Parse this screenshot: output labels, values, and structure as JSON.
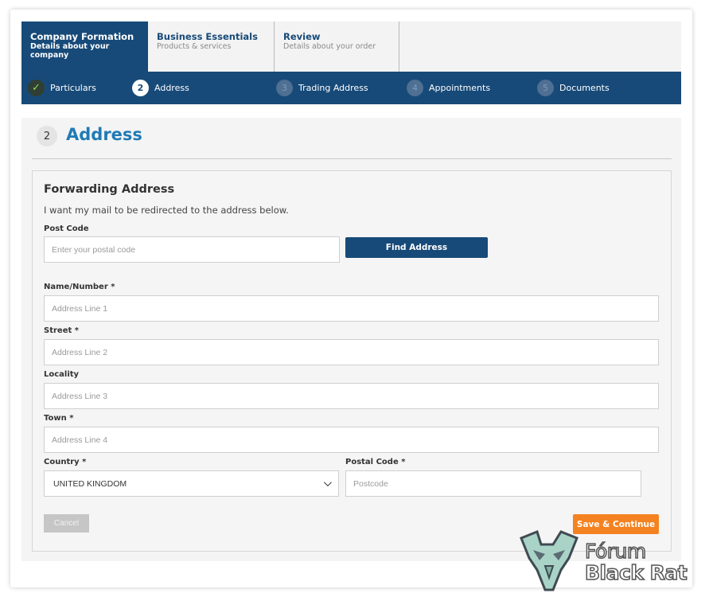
{
  "tabs": [
    {
      "title": "Company Formation",
      "subtitle": "Details about your company"
    },
    {
      "title": "Business Essentials",
      "subtitle": "Products & services"
    },
    {
      "title": "Review",
      "subtitle": "Details about your order"
    }
  ],
  "steps": [
    {
      "num": "✓",
      "label": "Particulars",
      "state": "done"
    },
    {
      "num": "2",
      "label": "Address",
      "state": "current"
    },
    {
      "num": "3",
      "label": "Trading Address",
      "state": "pending"
    },
    {
      "num": "4",
      "label": "Appointments",
      "state": "pending"
    },
    {
      "num": "5",
      "label": "Documents",
      "state": "pending"
    }
  ],
  "header": {
    "step_num": "2",
    "title": "Address"
  },
  "section": {
    "title": "Forwarding Address",
    "description": "I want my mail to be redirected to the address below."
  },
  "form": {
    "postcode_label": "Post Code",
    "postcode_placeholder": "Enter your postal code",
    "find_button": "Find Address",
    "name_label": "Name/Number *",
    "name_placeholder": "Address Line 1",
    "street_label": "Street *",
    "street_placeholder": "Address Line 2",
    "locality_label": "Locality",
    "locality_placeholder": "Address Line 3",
    "town_label": "Town *",
    "town_placeholder": "Address Line 4",
    "country_label": "Country *",
    "country_value": "UNITED KINGDOM",
    "postal_label": "Postal Code *",
    "postal_placeholder": "Postcode"
  },
  "actions": {
    "cancel": "Cancel",
    "save": "Save & Continue"
  },
  "watermark": {
    "line1": "Fórum",
    "line2": "Black Rat"
  },
  "colors": {
    "primary": "#174a78",
    "accent": "#f58220",
    "heading": "#1f7bb5"
  }
}
